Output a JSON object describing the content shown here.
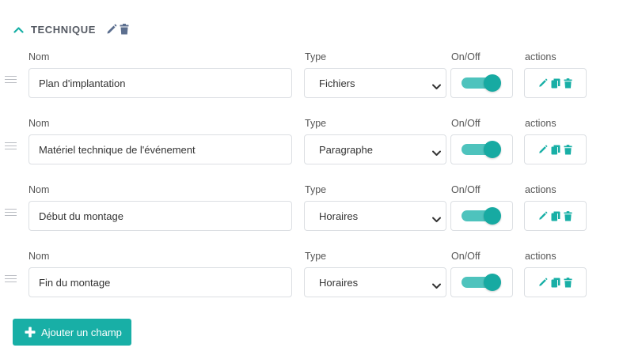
{
  "section": {
    "title": "TECHNIQUE",
    "icons": {
      "collapse": "chevron-up-icon",
      "edit": "pencil-icon",
      "delete": "trash-icon"
    },
    "colors": {
      "accent": "#18afa6",
      "title": "#555a63",
      "header_icons": "#5c6f8f"
    }
  },
  "labels": {
    "name": "Nom",
    "type": "Type",
    "onoff": "On/Off",
    "actions": "actions"
  },
  "fields": [
    {
      "name": "Plan d'implantation",
      "type": "Fichiers",
      "enabled": true
    },
    {
      "name": "Matériel technique de l'événement",
      "type": "Paragraphe",
      "enabled": true
    },
    {
      "name": "Début du montage",
      "type": "Horaires",
      "enabled": true
    },
    {
      "name": "Fin du montage",
      "type": "Horaires",
      "enabled": true
    }
  ],
  "row_action_icons": [
    "pencil-icon",
    "copy-icon",
    "trash-icon"
  ],
  "add_button": {
    "label": "Ajouter un champ",
    "icon": "plus-icon"
  }
}
